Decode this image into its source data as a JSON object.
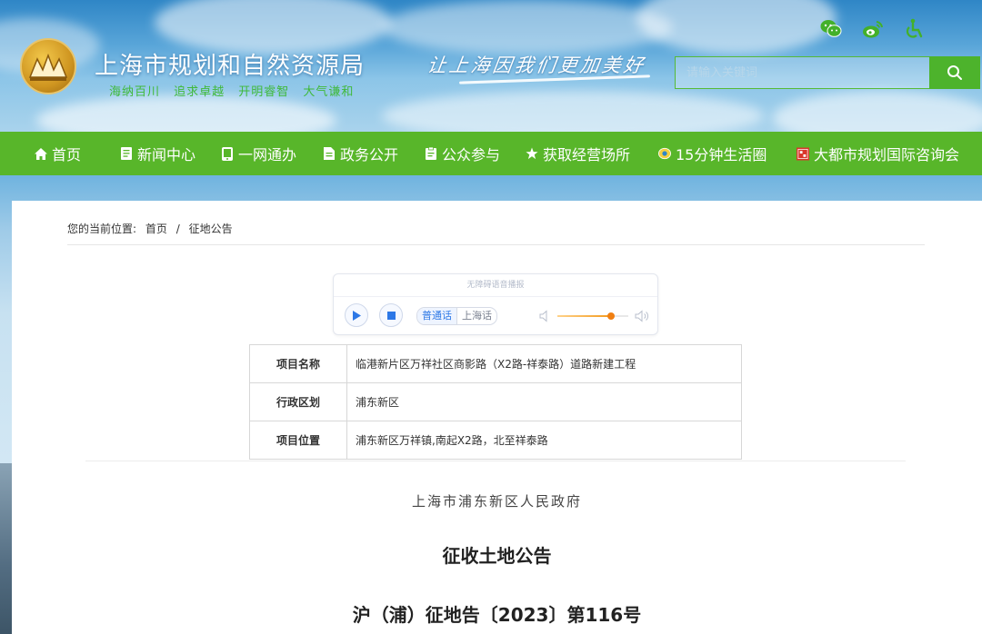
{
  "header": {
    "site_title": "上海市规划和自然资源局",
    "motto": "海纳百川 追求卓越 开明睿智 大气谦和",
    "slogan": "让上海因我们更加美好",
    "search_placeholder": "请输入关键词",
    "icons": [
      "wechat-icon",
      "weibo-icon",
      "accessibility-icon",
      "search-icon"
    ]
  },
  "nav": {
    "items": [
      {
        "label": "首页",
        "icon": "home-icon"
      },
      {
        "label": "新闻中心",
        "icon": "document-icon"
      },
      {
        "label": "一网通办",
        "icon": "phone-icon"
      },
      {
        "label": "政务公开",
        "icon": "document-icon"
      },
      {
        "label": "公众参与",
        "icon": "clipboard-icon"
      },
      {
        "label": "获取经营场所",
        "icon": "star-icon"
      },
      {
        "label": "15分钟生活圈",
        "icon": "badge-icon"
      },
      {
        "label": "大都市规划国际咨询会",
        "icon": "seal-icon"
      }
    ]
  },
  "breadcrumb": {
    "prefix": "您的当前位置:",
    "home": "首页",
    "separator": "/",
    "current": "征地公告"
  },
  "player": {
    "title": "无障碍语音播报",
    "lang_active": "普通话",
    "lang_inactive": "上海话",
    "volume": 0.75
  },
  "project_table": [
    {
      "key": "项目名称",
      "value": "临港新片区万祥社区商影路（X2路-祥泰路）道路新建工程"
    },
    {
      "key": "行政区划",
      "value": "浦东新区"
    },
    {
      "key": "项目位置",
      "value": "浦东新区万祥镇,南起X2路，北至祥泰路"
    }
  ],
  "document": {
    "issuer": "上海市浦东新区人民政府",
    "title": "征收土地公告",
    "number": "沪（浦）征地告〔2023〕第116号"
  },
  "colors": {
    "nav_green": "#58b62a",
    "motto_green": "#3fb93a",
    "player_blue": "#2d78e6",
    "volume_orange": "#f07f12"
  }
}
